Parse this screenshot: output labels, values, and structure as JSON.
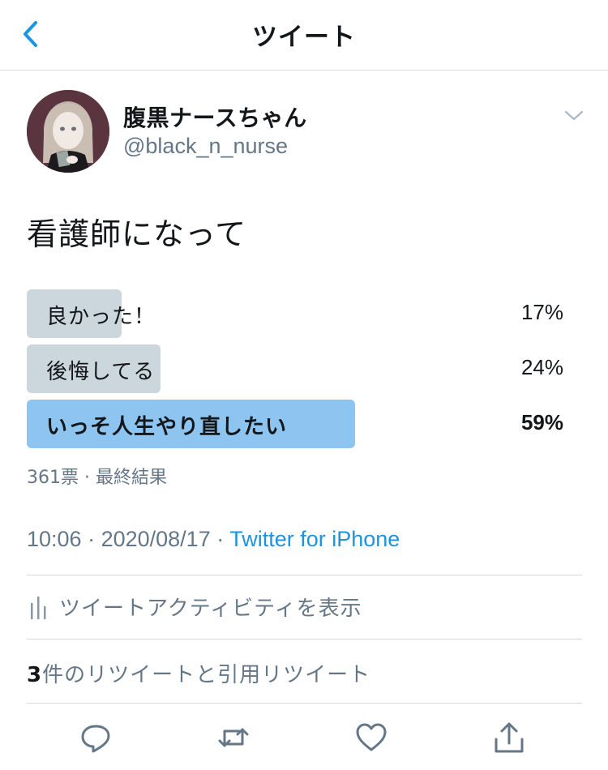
{
  "header": {
    "title": "ツイート",
    "back_icon": "chevron-left-icon"
  },
  "tweet": {
    "author": {
      "display_name": "腹黒ナースちゃん",
      "handle": "@black_n_nurse"
    },
    "text": "看護師になって",
    "poll": {
      "options": [
        {
          "label": "良かった！",
          "percent_text": "17%",
          "percent": 17
        },
        {
          "label": "後悔してる",
          "percent_text": "24%",
          "percent": 24
        },
        {
          "label": "いっそ人生やり直したい",
          "percent_text": "59%",
          "percent": 59
        }
      ],
      "meta": "361票 · 最終結果"
    },
    "time": "10:06",
    "date": "2020/08/17",
    "separator": " · ",
    "source": "Twitter for iPhone",
    "activity_label": "ツイートアクティビティを表示",
    "retweet_count": "3",
    "retweet_label": "件のリツイートと引用リツイート"
  },
  "actions": [
    "reply-icon",
    "retweet-icon",
    "like-icon",
    "share-icon"
  ],
  "colors": {
    "accent": "#1b95e0",
    "poll_bar": "#ccd6dd",
    "poll_bar_winner": "#8ec5f0",
    "secondary_text": "#657786"
  }
}
